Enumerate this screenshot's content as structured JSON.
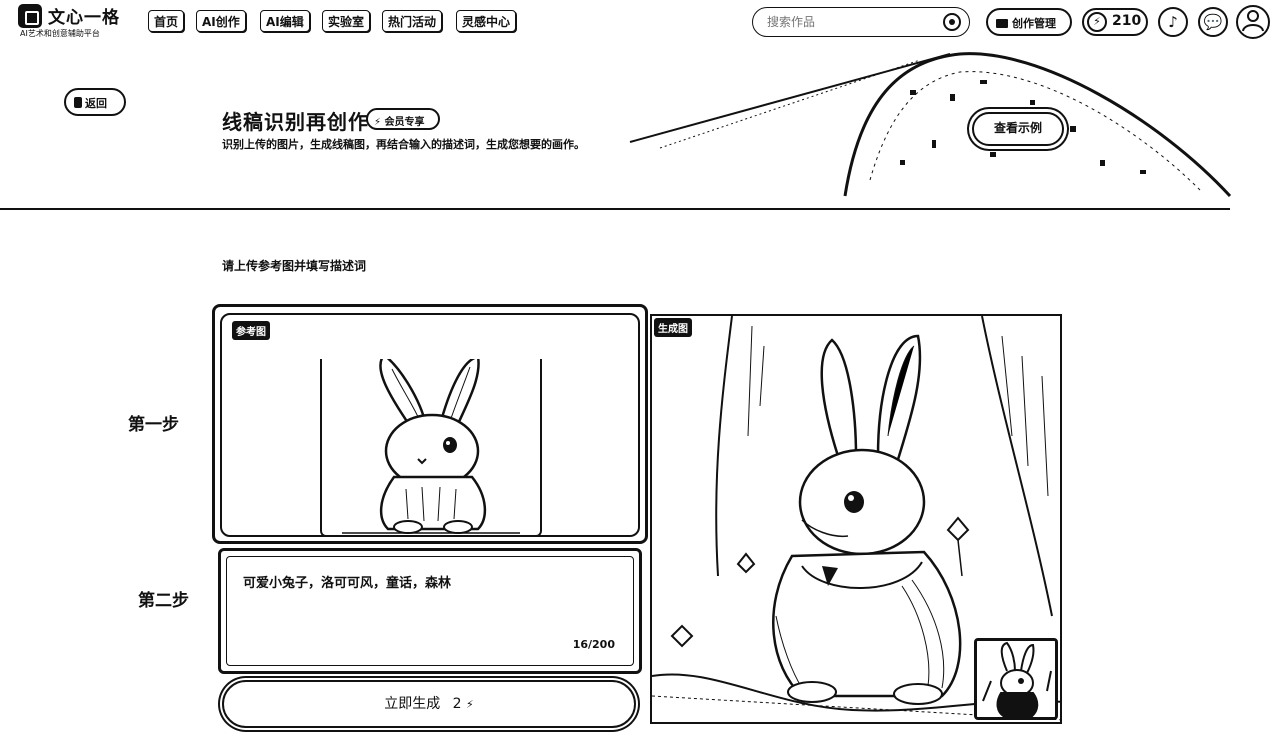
{
  "header": {
    "logo_title": "文心一格",
    "logo_subtitle": "AI艺术和创意辅助平台",
    "nav": [
      "首页",
      "AI创作",
      "AI编辑",
      "实验室",
      "热门活动",
      "灵感中心"
    ],
    "search_placeholder": "搜索作品",
    "works_label": "创作管理",
    "points_value": "210"
  },
  "banner": {
    "back_label": "返回",
    "title": "线稿识别再创作",
    "vip_badge": "会员专享",
    "description": "识别上传的图片，生成线稿图，再结合输入的描述词，生成您想要的画作。",
    "example_button": "查看示例"
  },
  "main": {
    "instruction": "请上传参考图并填写描述词",
    "step1_label": "第一步",
    "step2_label": "第二步",
    "reference_tag": "参考图",
    "generated_tag": "生成图",
    "description_text": "可爱小兔子，洛可可风，童话，森林",
    "char_counter": "16/200",
    "generate_label": "立即生成",
    "generate_cost": "2"
  },
  "icons": {
    "logo": "logo-cube-icon",
    "search": "search-icon",
    "folder": "folder-icon",
    "bolt": "bolt-icon",
    "tiktok": "tiktok-icon",
    "message": "message-icon",
    "avatar": "avatar-icon"
  }
}
